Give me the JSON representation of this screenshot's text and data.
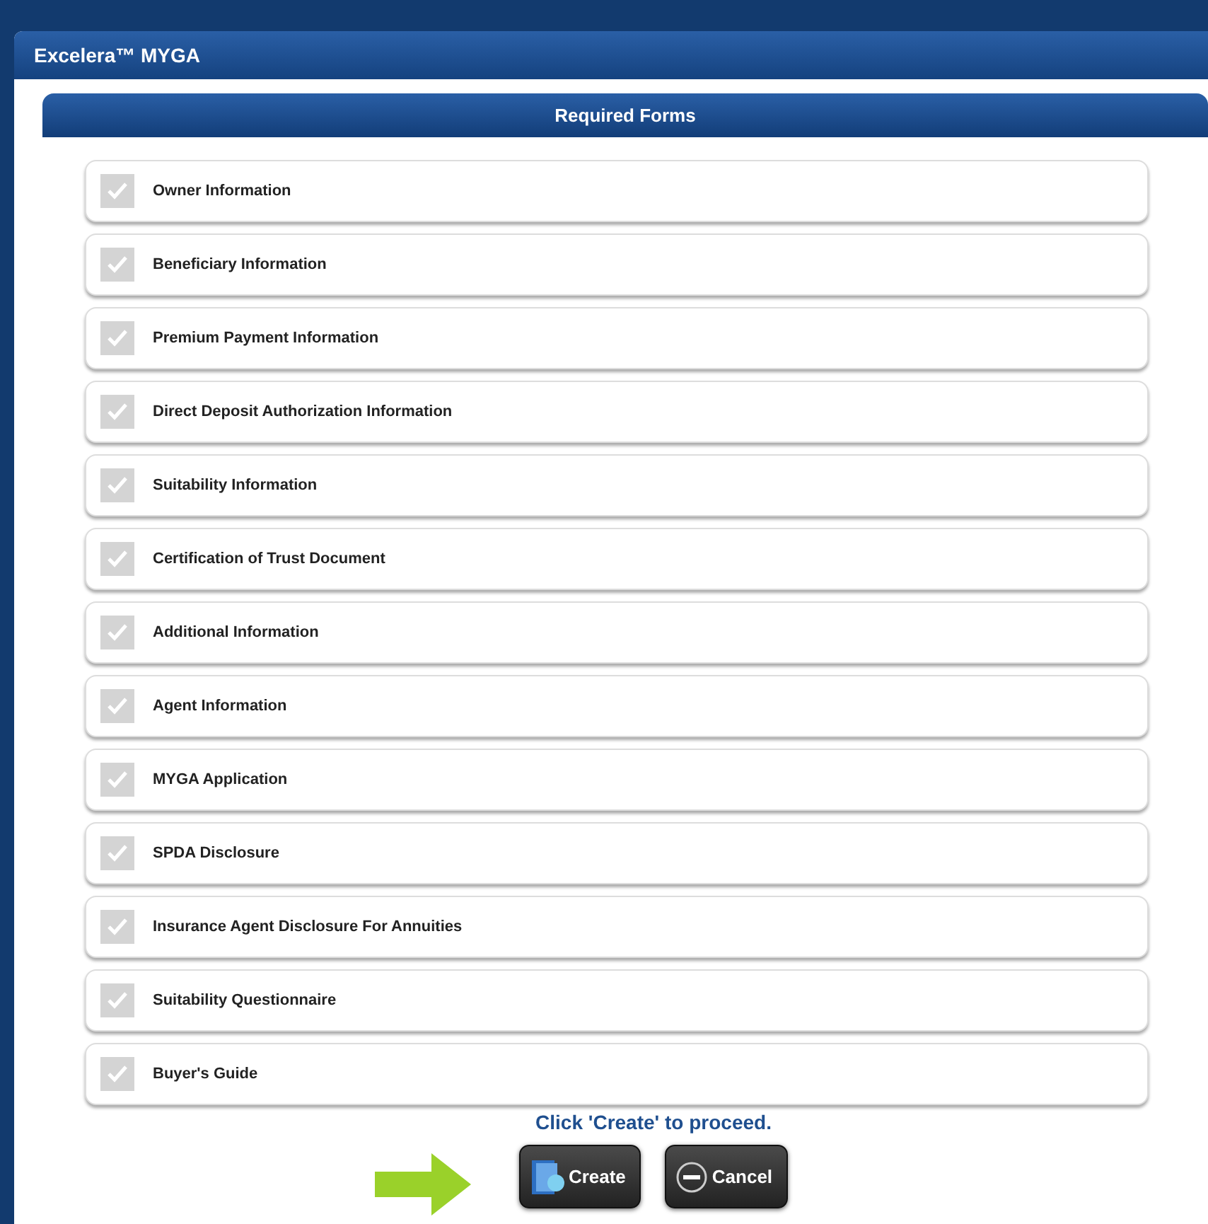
{
  "window": {
    "title": "Excelera™ MYGA"
  },
  "section": {
    "title": "Required Forms"
  },
  "forms": [
    {
      "label": "Owner Information",
      "checked": true
    },
    {
      "label": "Beneficiary Information",
      "checked": true
    },
    {
      "label": "Premium Payment Information",
      "checked": true
    },
    {
      "label": "Direct Deposit Authorization Information",
      "checked": true
    },
    {
      "label": "Suitability Information",
      "checked": true
    },
    {
      "label": "Certification of Trust Document",
      "checked": true
    },
    {
      "label": "Additional Information",
      "checked": true
    },
    {
      "label": "Agent Information",
      "checked": true
    },
    {
      "label": "MYGA Application",
      "checked": true
    },
    {
      "label": "SPDA Disclosure",
      "checked": true
    },
    {
      "label": "Insurance Agent Disclosure For Annuities",
      "checked": true
    },
    {
      "label": "Suitability Questionnaire",
      "checked": true
    },
    {
      "label": "Buyer's Guide",
      "checked": true
    }
  ],
  "instruction": "Click 'Create' to proceed.",
  "buttons": [
    {
      "kind": "create",
      "label": "Create"
    },
    {
      "kind": "cancel",
      "label": "Cancel"
    }
  ]
}
